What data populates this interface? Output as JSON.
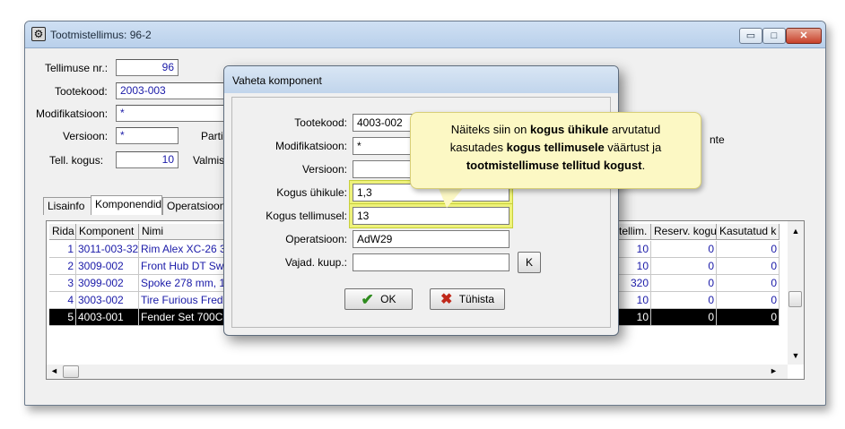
{
  "main_window": {
    "title": "Tootmistellimus: 96-2",
    "controls": {
      "minimize": "▭",
      "maximize": "□",
      "close": "✕"
    },
    "fields": {
      "tellimuse_nr_label": "Tellimuse nr.:",
      "tellimuse_nr_value": "96",
      "tootekood_label": "Tootekood:",
      "tootekood_value": "2003-003",
      "modifikatsioon_label": "Modifikatsioon:",
      "modifikatsioon_value": "*",
      "versioon_label": "Versioon:",
      "versioon_value": "*",
      "partii_label": "Partii",
      "tell_kogus_label": "Tell. kogus:",
      "tell_kogus_value": "10",
      "valmis_label": "Valmis",
      "right_partial_text": "nte"
    },
    "tabs": [
      "Lisainfo",
      "Komponendid",
      "Operatsioon"
    ],
    "active_tab": "Komponendid",
    "grid": {
      "headers": [
        "Rida",
        "Komponent",
        "Nimi",
        "tellim.",
        "Reserv. kogu",
        "Kasutatud k"
      ],
      "rows": [
        {
          "rida": "1",
          "komponent": "3011-003-32I",
          "nimi": "Rim Alex XC-26 32",
          "tellim": "10",
          "reserv": "0",
          "kasutatud": "0"
        },
        {
          "rida": "2",
          "komponent": "3009-002",
          "nimi": "Front Hub DT Sw",
          "tellim": "10",
          "reserv": "0",
          "kasutatud": "0"
        },
        {
          "rida": "3",
          "komponent": "3099-002",
          "nimi": "Spoke 278 mm, 1",
          "tellim": "320",
          "reserv": "0",
          "kasutatud": "0"
        },
        {
          "rida": "4",
          "komponent": "3003-002",
          "nimi": "Tire Furious Fred F",
          "tellim": "10",
          "reserv": "0",
          "kasutatud": "0"
        },
        {
          "rida": "5",
          "komponent": "4003-001",
          "nimi": "Fender Set 700C",
          "tellim": "10",
          "reserv": "0",
          "kasutatud": "0"
        }
      ],
      "selected_row": "5"
    },
    "scroll": {
      "up": "▲",
      "down": "▼",
      "left": "◄",
      "right": "►"
    }
  },
  "dialog": {
    "title": "Vaheta komponent",
    "tootekood_label": "Tootekood:",
    "tootekood_value": "4003-002",
    "modifikatsioon_label": "Modifikatsioon:",
    "modifikatsioon_value": "*",
    "versioon_label": "Versioon:",
    "versioon_value": "",
    "kogus_uhikule_label": "Kogus ühikule:",
    "kogus_uhikule_value": "1,3",
    "kogus_tellimusel_label": "Kogus tellimusel:",
    "kogus_tellimusel_value": "13",
    "operatsioon_label": "Operatsioon:",
    "operatsioon_value": "AdW29",
    "vajad_kuup_label": "Vajad. kuup.:",
    "vajad_kuup_value": "",
    "k_button": "K",
    "ok_button": "OK",
    "cancel_button": "Tühista",
    "ok_icon": "checkmark-icon",
    "cancel_icon": "x-icon"
  },
  "callout": {
    "line1_a": "Näiteks siin on ",
    "line1_b": "kogus ühikule",
    "line1_c": " arvutatud",
    "line2_a": "kasutades ",
    "line2_b": "kogus tellimusele",
    "line2_c": " väärtust ja",
    "line3_b": "tootmistellimuse tellitud kogust",
    "line3_c": "."
  },
  "colors": {
    "highlight": "#eef27a",
    "callout_bg": "#fcf8c4",
    "grid_text": "#1a1aa8",
    "selected_row_bg": "#000000"
  }
}
